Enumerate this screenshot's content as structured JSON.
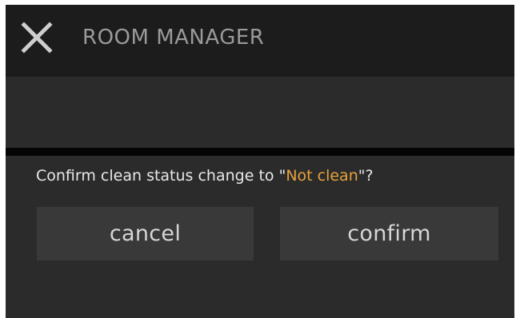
{
  "header": {
    "title": "ROOM MANAGER",
    "close_icon": "close-icon"
  },
  "dialog": {
    "message_prefix": "Confirm clean status change to \"",
    "message_status": "Not clean",
    "message_suffix": "\"?",
    "cancel_label": "cancel",
    "confirm_label": "confirm"
  },
  "colors": {
    "background": "#2b2b2b",
    "header": "#1c1c1c",
    "divider": "#050505",
    "button": "#393939",
    "accent": "#e8a23a"
  }
}
